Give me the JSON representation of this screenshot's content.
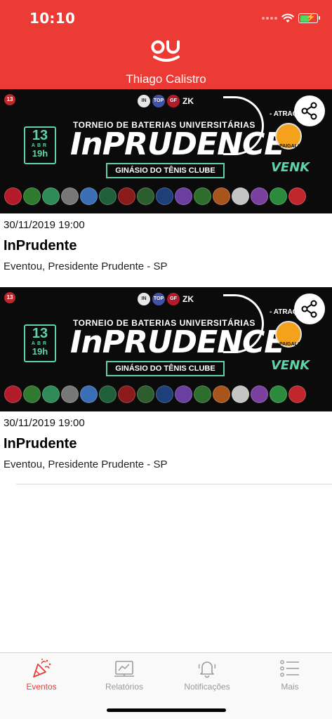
{
  "status_bar": {
    "time": "10:10"
  },
  "header": {
    "user_name": "Thiago Calistro",
    "brand_color": "#ec3b35"
  },
  "events": [
    {
      "date_time": "30/11/2019 19:00",
      "title": "InPrudente",
      "location": "Eventou, Presidente Prudente - SP",
      "banner": {
        "corner_badge": "13",
        "top_logos": [
          "IN",
          "TOP",
          "GF",
          "ZK"
        ],
        "day": "13",
        "month": "ABR",
        "hour": "19h",
        "subtitle": "TORNEIO DE BATERIAS UNIVERSITÁRIAS",
        "headline": "InPRUDENCE",
        "venue": "GINÁSIO DO TÊNIS CLUBE",
        "attraction_label": "- ATRAÇ",
        "attraction_name": "PAIGALO",
        "sponsor": "VENK"
      }
    },
    {
      "date_time": "30/11/2019 19:00",
      "title": "InPrudente",
      "location": "Eventou, Presidente Prudente - SP",
      "banner": {
        "corner_badge": "13",
        "top_logos": [
          "IN",
          "TOP",
          "GF",
          "ZK"
        ],
        "day": "13",
        "month": "ABR",
        "hour": "19h",
        "subtitle": "TORNEIO DE BATERIAS UNIVERSITÁRIAS",
        "headline": "InPRUDENCE",
        "venue": "GINÁSIO DO TÊNIS CLUBE",
        "attraction_label": "- ATRAÇ",
        "attraction_name": "PAIGALO",
        "sponsor": "VENK"
      }
    }
  ],
  "tabbar": {
    "tabs": [
      {
        "label": "Eventos",
        "icon": "party-popper-icon",
        "active": true
      },
      {
        "label": "Relatórios",
        "icon": "report-icon",
        "active": false
      },
      {
        "label": "Notificações",
        "icon": "bell-icon",
        "active": false
      },
      {
        "label": "Mais",
        "icon": "list-icon",
        "active": false
      }
    ],
    "active_color": "#ec3b35",
    "inactive_color": "#9a9a9a"
  }
}
